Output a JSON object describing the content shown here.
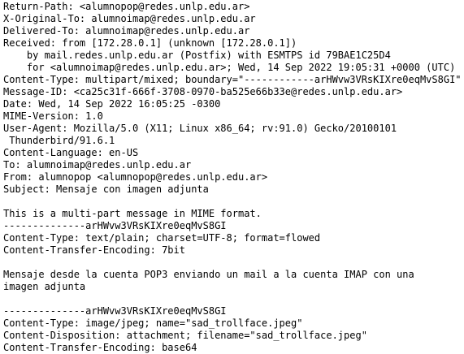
{
  "email_source": {
    "lines": [
      "Return-Path: <alumnopop@redes.unlp.edu.ar>",
      "X-Original-To: alumnoimap@redes.unlp.edu.ar",
      "Delivered-To: alumnoimap@redes.unlp.edu.ar",
      "Received: from [172.28.0.1] (unknown [172.28.0.1])",
      "    by mail.redes.unlp.edu.ar (Postfix) with ESMTPS id 79BAE1C25D4",
      "    for <alumnoimap@redes.unlp.edu.ar>; Wed, 14 Sep 2022 19:05:31 +0000 (UTC)",
      "Content-Type: multipart/mixed; boundary=\"------------arHWvw3VRsKIXre0eqMvS8GI\"",
      "Message-ID: <ca25c31f-666f-3708-0970-ba525e66b33e@redes.unlp.edu.ar>",
      "Date: Wed, 14 Sep 2022 16:05:25 -0300",
      "MIME-Version: 1.0",
      "User-Agent: Mozilla/5.0 (X11; Linux x86_64; rv:91.0) Gecko/20100101",
      " Thunderbird/91.6.1",
      "Content-Language: en-US",
      "To: alumnoimap@redes.unlp.edu.ar",
      "From: alumnopop <alumnopop@redes.unlp.edu.ar>",
      "Subject: Mensaje con imagen adjunta",
      "",
      "This is a multi-part message in MIME format.",
      "--------------arHWvw3VRsKIXre0eqMvS8GI",
      "Content-Type: text/plain; charset=UTF-8; format=flowed",
      "Content-Transfer-Encoding: 7bit",
      "",
      "Mensaje desde la cuenta POP3 enviando un mail a la cuenta IMAP con una",
      "imagen adjunta",
      "",
      "--------------arHWvw3VRsKIXre0eqMvS8GI",
      "Content-Type: image/jpeg; name=\"sad_trollface.jpeg\"",
      "Content-Disposition: attachment; filename=\"sad_trollface.jpeg\"",
      "Content-Transfer-Encoding: base64"
    ]
  }
}
